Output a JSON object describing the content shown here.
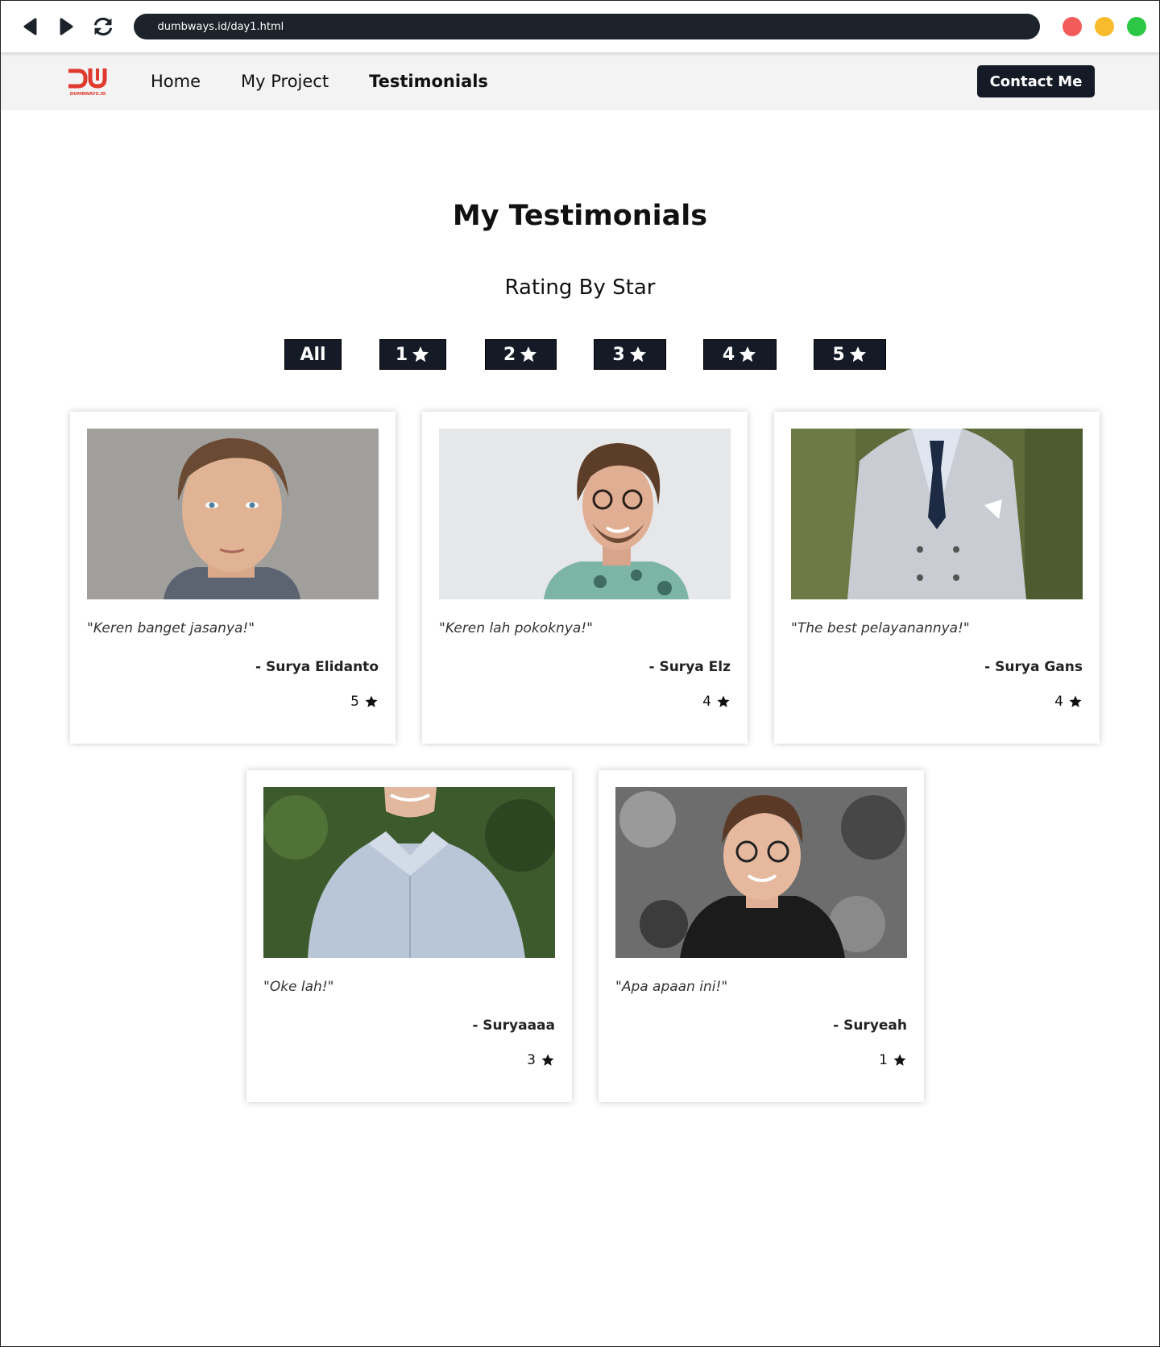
{
  "browser": {
    "url": "dumbways.id/day1.html"
  },
  "colors": {
    "dark": "#141a26",
    "close": "#f35a5a",
    "minimize": "#f8bb2c",
    "maximize": "#2cc745",
    "logo": "#e03a2f"
  },
  "nav": {
    "logo_text": "DUMBWAYS.ID",
    "links": [
      "Home",
      "My Project",
      "Testimonials"
    ],
    "active": "Testimonials",
    "contact": "Contact Me"
  },
  "page": {
    "title": "My Testimonials",
    "subtitle": "Rating By Star"
  },
  "filters": [
    "All",
    "1",
    "2",
    "3",
    "4",
    "5"
  ],
  "testimonials": [
    {
      "quote": "\"Keren banget jasanya!\"",
      "author": "- Surya Elidanto",
      "rating": "5"
    },
    {
      "quote": "\"Keren lah pokoknya!\"",
      "author": "- Surya Elz",
      "rating": "4"
    },
    {
      "quote": "\"The best pelayanannya!\"",
      "author": "- Surya Gans",
      "rating": "4"
    },
    {
      "quote": "\"Oke lah!\"",
      "author": "- Suryaaaa",
      "rating": "3"
    },
    {
      "quote": "\"Apa apaan ini!\"",
      "author": "- Suryeah",
      "rating": "1"
    }
  ]
}
